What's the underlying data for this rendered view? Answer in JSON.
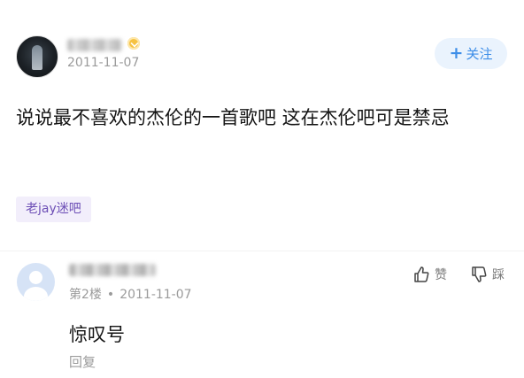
{
  "post": {
    "date": "2011-11-07",
    "follow_label": "关注",
    "follow_plus": "+",
    "text": "说说最不喜欢的杰伦的一首歌吧 这在杰伦吧可是禁忌",
    "tag": "老jay迷吧"
  },
  "comment": {
    "floor": "第2楼",
    "separator": "•",
    "date": "2011-11-07",
    "like_label": "赞",
    "dislike_label": "踩",
    "text": "惊叹号",
    "reply_label": "回复"
  }
}
